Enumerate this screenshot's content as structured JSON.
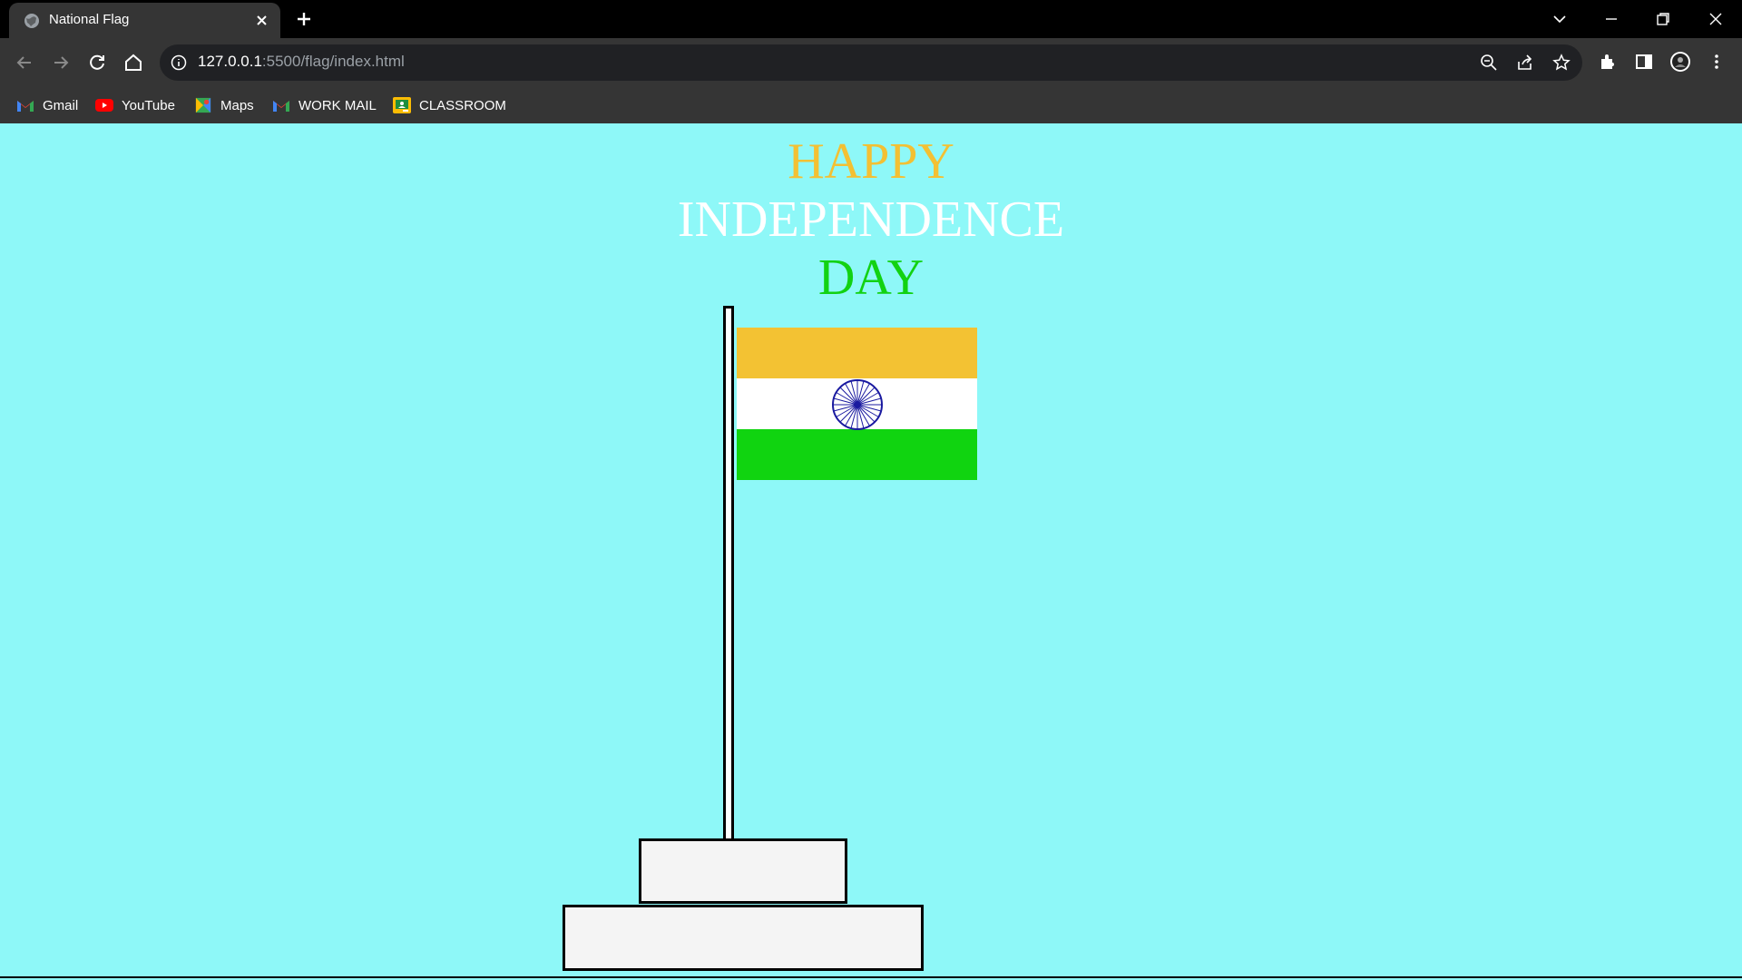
{
  "browser": {
    "tab_title": "National Flag",
    "url_host": "127.0.0.1",
    "url_rest": ":5500/flag/index.html",
    "bookmarks": [
      {
        "label": "Gmail",
        "icon": "gmail-icon"
      },
      {
        "label": "YouTube",
        "icon": "youtube-icon"
      },
      {
        "label": "Maps",
        "icon": "maps-icon"
      },
      {
        "label": "WORK MAIL",
        "icon": "gmail-icon"
      },
      {
        "label": "CLASSROOM",
        "icon": "classroom-icon"
      }
    ]
  },
  "heading": {
    "line1": "HAPPY",
    "line2": "INDEPENDENCE",
    "line3": "DAY"
  },
  "colors": {
    "page_background": "#8ef8f8",
    "saffron": "#f3c233",
    "white": "#ffffff",
    "green": "#10d410",
    "chakra": "#1a1aa0"
  }
}
